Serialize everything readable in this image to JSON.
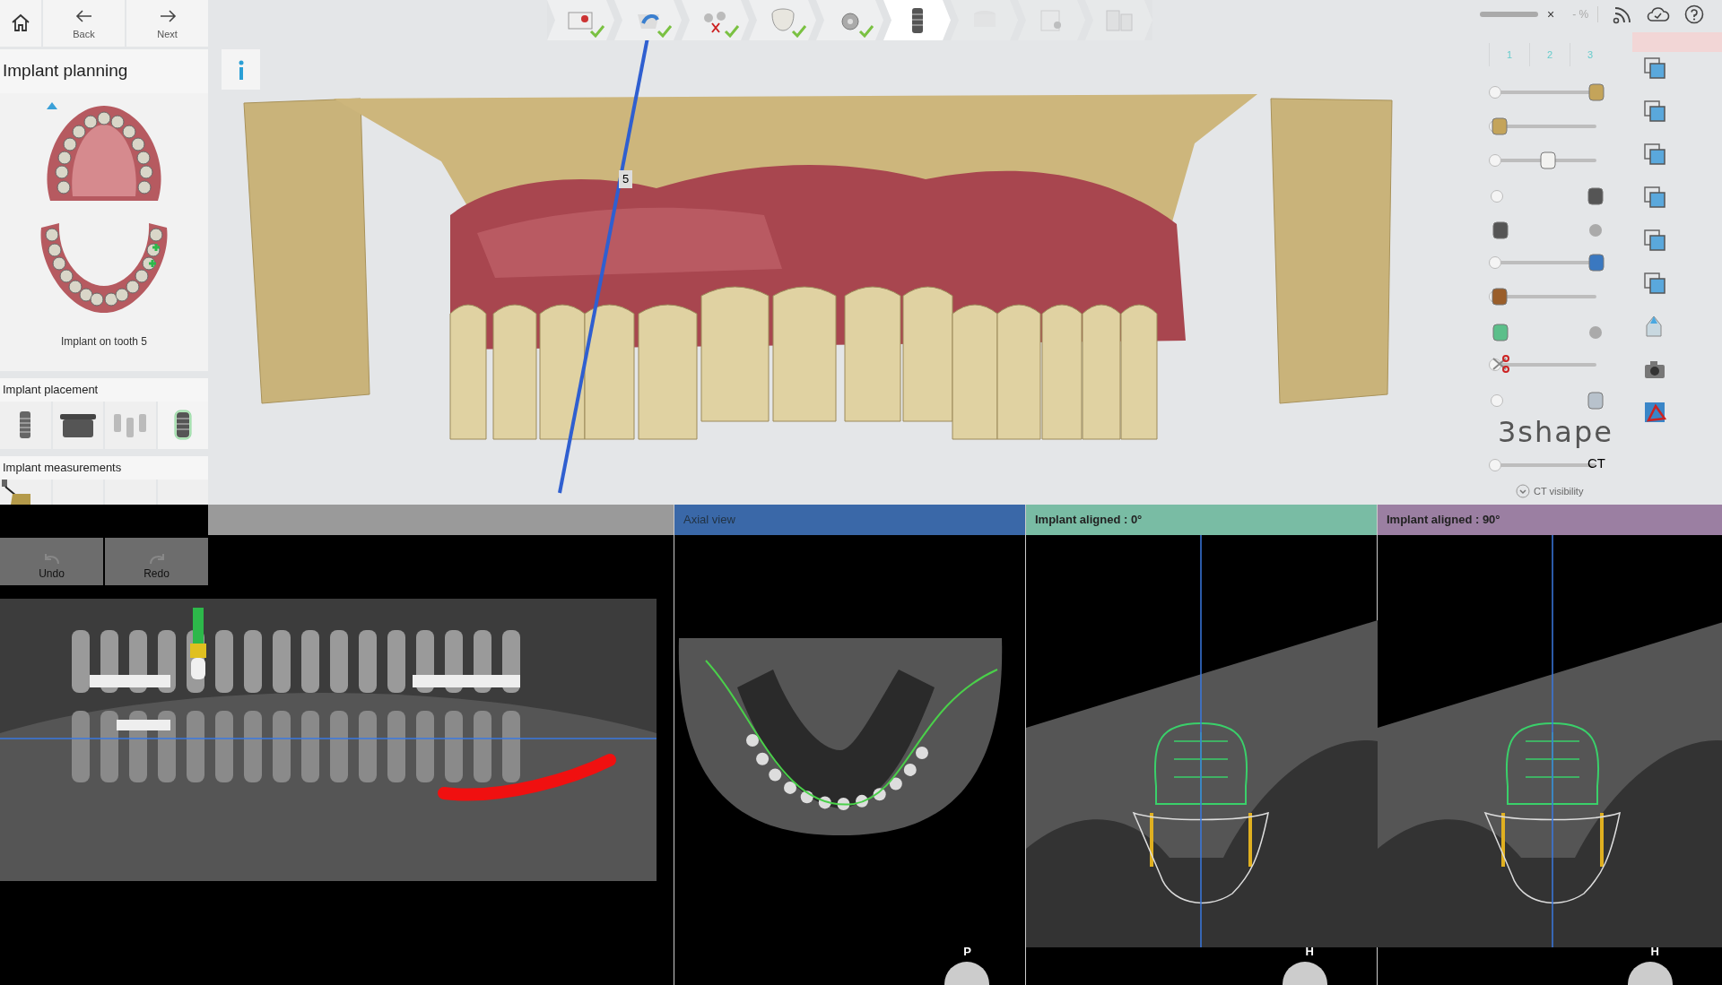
{
  "nav": [
    {
      "label": "Back"
    },
    {
      "label": "Next"
    }
  ],
  "panel": {
    "title": "Implant planning",
    "caption": "Implant on tooth 5",
    "placement": {
      "title": "Implant placement",
      "tools": [
        {
          "selected": false
        },
        {
          "selected": false
        },
        {
          "selected": false
        },
        {
          "selected": true
        }
      ]
    },
    "measurements": {
      "title": "Implant measurements"
    }
  },
  "history": [
    {
      "label": "Undo"
    },
    {
      "label": "Redo"
    }
  ],
  "workflow": [
    {
      "done": true,
      "selected": false
    },
    {
      "done": true,
      "selected": false
    },
    {
      "done": true,
      "selected": false
    },
    {
      "done": true,
      "selected": false
    },
    {
      "done": true,
      "selected": false
    },
    {
      "done": false,
      "selected": true
    },
    {
      "done": false,
      "selected": false
    },
    {
      "done": false,
      "selected": false
    },
    {
      "done": false,
      "selected": false
    }
  ],
  "status": {
    "close": "×",
    "zoom": "- %"
  },
  "scene": {
    "tooth_label": "5"
  },
  "view_tabs": [
    {
      "label": "1"
    },
    {
      "label": "2"
    },
    {
      "label": "3"
    }
  ],
  "visibility": [
    {
      "kind": "slider",
      "level": 1
    },
    {
      "kind": "slider",
      "level": 0
    },
    {
      "kind": "slider",
      "level": 0.5
    },
    {
      "kind": "switch",
      "on": true
    },
    {
      "kind": "switch",
      "on": false
    },
    {
      "kind": "slider",
      "level": 1
    },
    {
      "kind": "slider",
      "level": 0
    },
    {
      "kind": "switch",
      "on": false
    },
    {
      "kind": "slider",
      "level": 0
    },
    {
      "kind": "switch",
      "on": true
    },
    {
      "kind": "slider",
      "level": 1,
      "label": "CT"
    }
  ],
  "logo": "3shape",
  "ct_visibility": "CT visibility",
  "views": [
    {
      "kind": "panoramic",
      "color": "#9a9a9a"
    },
    {
      "kind": "axial",
      "title": "Axial view",
      "color": "#3a68a8",
      "marker": "P"
    },
    {
      "kind": "aligned",
      "title": "Implant aligned : 0°",
      "color": "#79bca4",
      "marker": "H"
    },
    {
      "kind": "aligned",
      "title": "Implant aligned : 90°",
      "color": "#9b7fa2",
      "marker": "H"
    }
  ]
}
